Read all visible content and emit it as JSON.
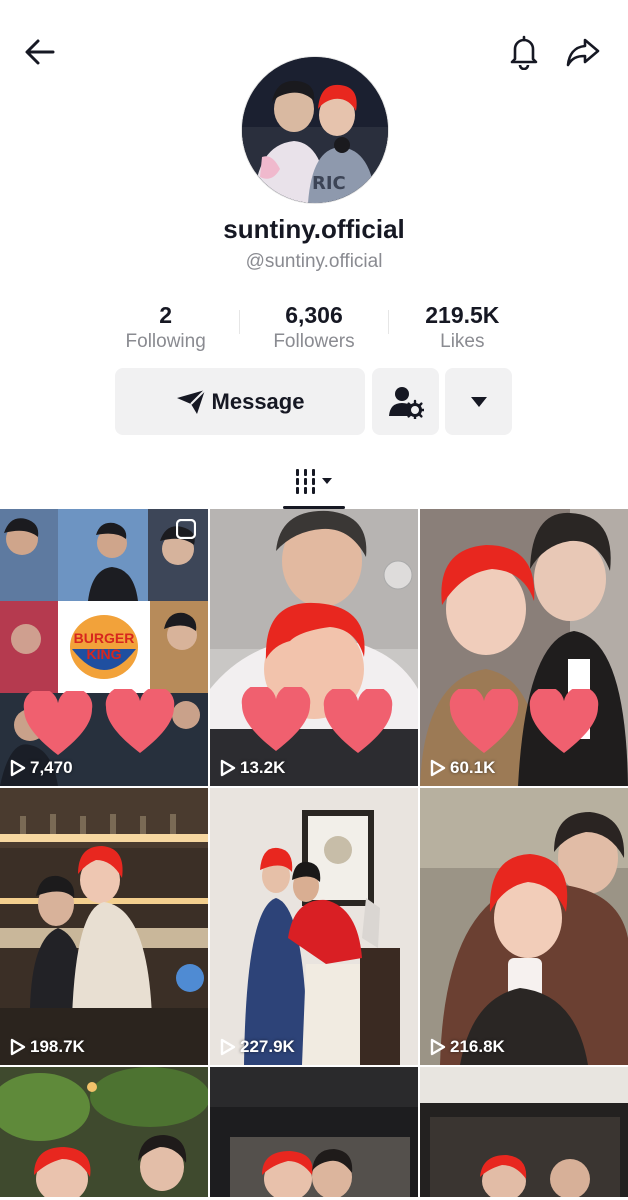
{
  "profile": {
    "display_name": "suntiny.official",
    "handle": "@suntiny.official"
  },
  "stats": {
    "following_value": "2",
    "following_label": "Following",
    "followers_value": "6,306",
    "followers_label": "Followers",
    "likes_value": "219.5K",
    "likes_label": "Likes"
  },
  "actions": {
    "message_label": "Message"
  },
  "videos": [
    {
      "views": "7,470"
    },
    {
      "views": "13.2K"
    },
    {
      "views": "60.1K"
    },
    {
      "views": "198.7K"
    },
    {
      "views": "227.9K"
    },
    {
      "views": "216.8K"
    }
  ],
  "thumbnail_text": {
    "burger_king_line1": "BURGER",
    "burger_king_line2": "KING"
  },
  "icons": {
    "back": "arrow-left-icon",
    "bell": "bell-icon",
    "share": "share-arrow-icon",
    "message": "paper-plane-icon",
    "add_friend": "person-gear-icon",
    "more": "triangle-down-icon",
    "grid_tab": "bars-grid-icon",
    "play": "play-icon",
    "heart": "heart-sticker-icon",
    "multi": "multi-photo-icon"
  },
  "colors": {
    "text_primary": "#161823",
    "text_secondary": "#8a8b91",
    "button_bg": "#f1f1f2",
    "heart_pink": "#f0606f",
    "hair_red": "#e8271f"
  }
}
